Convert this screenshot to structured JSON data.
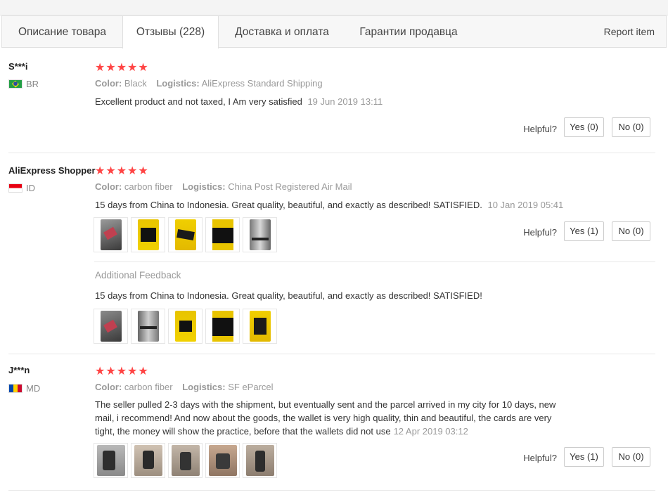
{
  "tabs": [
    {
      "label": "Описание товара"
    },
    {
      "label": "Отзывы (228)"
    },
    {
      "label": "Доставка и оплата"
    },
    {
      "label": "Гарантии продавца"
    }
  ],
  "report_label": "Report item",
  "labels": {
    "color": "Color:",
    "logistics": "Logistics:",
    "helpful": "Helpful?",
    "additional_feedback": "Additional Feedback"
  },
  "reviews": [
    {
      "user": "S***i",
      "country": "BR",
      "rating": "★★★★★",
      "color": "Black",
      "logistics": "AliExpress Standard Shipping",
      "text": "Excellent product and not taxed, I Am very satisfied",
      "date": "19 Jun 2019 13:11",
      "yes": "Yes (0)",
      "no": "No (0)"
    },
    {
      "user": "AliExpress Shopper",
      "country": "ID",
      "rating": "★★★★★",
      "color": "carbon fiber",
      "logistics": "China Post Registered Air Mail",
      "text": "15 days from China to Indonesia. Great quality, beautiful, and exactly as described! SATISFIED.",
      "date": "10 Jan 2019 05:41",
      "additional_text": "15 days from China to Indonesia. Great quality, beautiful, and exactly as described! SATISFIED!",
      "yes": "Yes (1)",
      "no": "No (0)"
    },
    {
      "user": "J***n",
      "country": "MD",
      "rating": "★★★★★",
      "color": "carbon fiber",
      "logistics": "SF eParcel",
      "text_lines": [
        "The seller pulled 2-3 days with the shipment, but eventually sent and the parcel arrived in my city for 10 days, new",
        "mail, i recommend! And now about the goods, the wallet is very high quality, thin and beautiful, the cards are very",
        "tight, the money will show the practice, before that the wallets did not use"
      ],
      "date": "12 Apr 2019 03:12",
      "yes": "Yes (1)",
      "no": "No (0)"
    }
  ]
}
